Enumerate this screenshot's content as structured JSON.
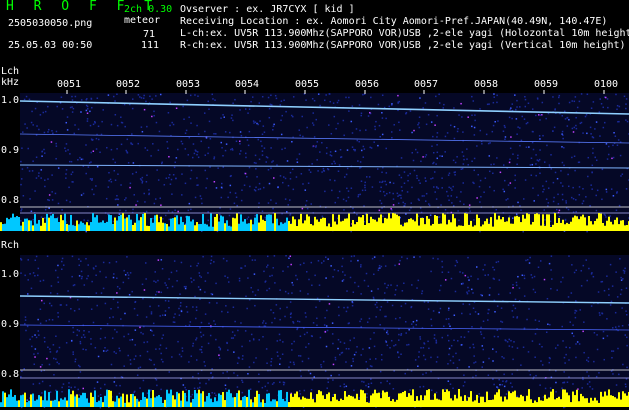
{
  "header": {
    "title": "H R O F F T",
    "filename": "2505030050.png",
    "datetime": "25.05.03 00:50",
    "channel_version": "2ch 0.30",
    "meteor_label": "meteor",
    "meteor_count_l": "71",
    "meteor_count_r": "111"
  },
  "info": {
    "observer": "Ovserver           : ex. JR7CYX [ kid ]",
    "location": "Receiving Location : ex. Aomori City Aomori-Pref.JAPAN(40.49N, 140.47E)",
    "lch": "L-ch:ex. UV5R 113.900Mhz(SAPPORO VOR)USB ,2-ele yagi (Holozontal 10m height)",
    "rch": "R-ch:ex. UV5R 113.900Mhz(SAPPORO VOR)USB ,2-ele yagi (Vertical 10m height)"
  },
  "left_panel": {
    "channel_label": "Lch",
    "unit_label": "kHz",
    "y_labels": [
      "1.0",
      "0.9",
      "0.8"
    ]
  },
  "right_panel": {
    "channel_label": "Rch",
    "y_labels": [
      "1.0",
      "0.9",
      "0.8"
    ]
  },
  "time_ticks": [
    "0051",
    "0052",
    "0053",
    "0054",
    "0055",
    "0056",
    "0057",
    "0058",
    "0059",
    "0100"
  ],
  "colors": {
    "background": "#000000",
    "title_green": "#00ff00",
    "noise_blue": "#1a2a9a",
    "activity_yellow": "#ffff00",
    "activity_cyan": "#00c8ff"
  }
}
